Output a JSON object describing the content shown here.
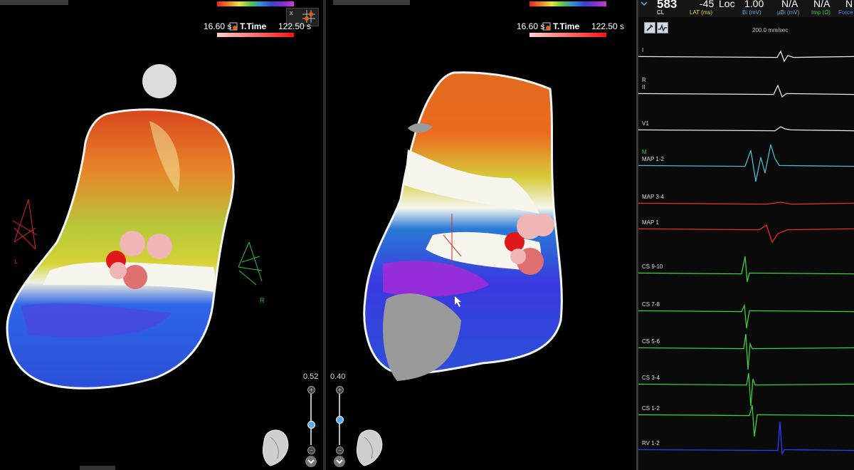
{
  "left_view": {
    "time_start": "16.60",
    "time_start_unit": "s",
    "time_label": "T.Time",
    "time_end": "122.50 s",
    "zoom_value": "0.52",
    "close_mark": "x",
    "orient_left": "L",
    "orient_right": "R"
  },
  "mid_view": {
    "time_start": "16.60",
    "time_start_unit": "s",
    "time_label": "T.Time",
    "time_end": "122.50 s",
    "zoom_value": "0.40"
  },
  "ecg": {
    "header": {
      "cl_value": "583",
      "cl_label": "CL",
      "lat_value": "-45",
      "lat_label": "LAT (ms)",
      "loc_value": "Loc",
      "bi_value": "1.00",
      "bi_label": "Bi (mV)",
      "ubi_value": "N/A",
      "ubi_label": "µBi (mV)",
      "imp_value": "N/A",
      "imp_label": "Imp (Ω)",
      "force_value": "N",
      "force_label": "Force"
    },
    "sweep_speed": "200.0 mm/sec",
    "channels": [
      {
        "label": "I",
        "color": "#e8e8e8"
      },
      {
        "label": "II",
        "color": "#e8e8e8",
        "marker": "R"
      },
      {
        "label": "V1",
        "color": "#e8e8e8"
      },
      {
        "label": "MAP 1-2",
        "color": "#4fb8d0",
        "marker": "M"
      },
      {
        "label": "MAP 3-4",
        "color": "#e82828"
      },
      {
        "label": "MAP 1",
        "color": "#e82828"
      },
      {
        "label": "CS 9-10",
        "color": "#3ccf3c"
      },
      {
        "label": "CS 7-8",
        "color": "#3ccf3c"
      },
      {
        "label": "CS 5-6",
        "color": "#3ccf3c"
      },
      {
        "label": "CS 3-4",
        "color": "#3ccf3c"
      },
      {
        "label": "CS 1-2",
        "color": "#3ccf3c"
      },
      {
        "label": "RV 1-2",
        "color": "#2a3cff"
      }
    ]
  },
  "colors": {
    "accent_blue": "#5fa8e8",
    "lat_yellow": "#e8d44a",
    "imp_green": "#3ccf3c",
    "force_blue": "#4a7cff"
  }
}
